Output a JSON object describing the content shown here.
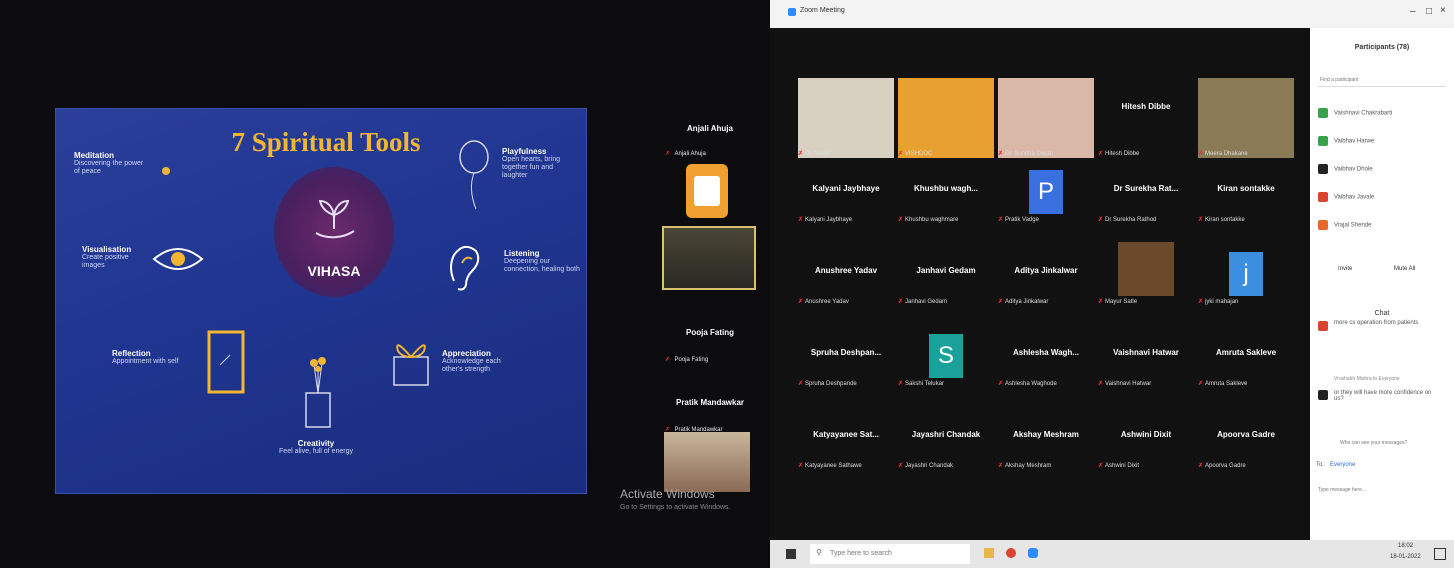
{
  "slide": {
    "title": "7 Spiritual Tools",
    "logo_text": "VIHASA",
    "tools": [
      {
        "heading": "Meditation",
        "desc": "Discovering the power of peace"
      },
      {
        "heading": "Visualisation",
        "desc": "Create positive images"
      },
      {
        "heading": "Reflection",
        "desc": "Appointment with self"
      },
      {
        "heading": "Creativity",
        "desc": "Feel alive, full of energy"
      },
      {
        "heading": "Appreciation",
        "desc": "Acknowledge each other's strength"
      },
      {
        "heading": "Listening",
        "desc": "Deepening our connection, healing both"
      },
      {
        "heading": "Playfulness",
        "desc": "Open hearts, bring together fun and laughter"
      }
    ]
  },
  "left_gallery": {
    "names": [
      "Anjali Ahuja",
      "Pooja Fating",
      "Pratik Mandawkar"
    ],
    "labels": [
      "Anjali Ahuja",
      "Pooja Fating",
      "Pratik Mandawkar"
    ],
    "activate": "Activate Windows",
    "activate_sub": "Go to Settings to activate Windows."
  },
  "zoom": {
    "window_title": "Zoom Meeting",
    "tiles": [
      {
        "name": "",
        "label": "Dr. Nikhil"
      },
      {
        "name": "",
        "label": "VISHDOC"
      },
      {
        "name": "",
        "label": "Dr. Sunitha Diwan"
      },
      {
        "name": "Hitesh Dibbe",
        "label": "Hitesh Dibbe"
      },
      {
        "name": "",
        "label": "Meera Dhakane"
      },
      {
        "name": "Kalyani Jaybhaye",
        "label": "Kalyani Jaybhaye"
      },
      {
        "name": "Khushbu wagh...",
        "label": "Khushbu waghmare"
      },
      {
        "name": "",
        "label": "Pratik Vadge",
        "letter": "P",
        "color": "#3a6fe0"
      },
      {
        "name": "Dr Surekha Rat...",
        "label": "Dr Surekha Rathod"
      },
      {
        "name": "Kiran sontakke",
        "label": "Kiran sontakke"
      },
      {
        "name": "Anushree Yadav",
        "label": "Anushree Yadav"
      },
      {
        "name": "Janhavi Gedam",
        "label": "Janhavi Gedam"
      },
      {
        "name": "Aditya Jinkalwar",
        "label": "Aditya Jinkalwar"
      },
      {
        "name": "",
        "label": "Mayur Satle"
      },
      {
        "name": "",
        "label": "jyki mahajan",
        "letter": "j",
        "color": "#3a8fe0"
      },
      {
        "name": "Spruha Deshpan...",
        "label": "Spruha Deshpande"
      },
      {
        "name": "",
        "label": "Sakshi Telukar",
        "letter": "S",
        "color": "#1aa19a"
      },
      {
        "name": "Ashlesha Wagh...",
        "label": "Ashlesha Waghode"
      },
      {
        "name": "Vaishnavi Hatwar",
        "label": "Vaishnavi Hatwar"
      },
      {
        "name": "Amruta Sakleve",
        "label": "Amruta Sakleve"
      },
      {
        "name": "Katyayanee Sat...",
        "label": "Katyayanee Sathawe"
      },
      {
        "name": "Jayashri Chandak",
        "label": "Jayashri Chandak"
      },
      {
        "name": "Akshay Meshram",
        "label": "Akshay Meshram"
      },
      {
        "name": "Ashwini Dixit",
        "label": "Ashwini Dixit"
      },
      {
        "name": "Apoorva Gadre",
        "label": "Apoorva Gadre"
      }
    ]
  },
  "panel": {
    "participants_title": "Participants (78)",
    "search_placeholder": "Find a participant",
    "participants": [
      {
        "name": "Vaishnavi Chakrabarti",
        "color": "#3aa04a"
      },
      {
        "name": "Vaibhav Harwe",
        "color": "#3aa04a"
      },
      {
        "name": "Vaibhav Dhole",
        "color": "#222222"
      },
      {
        "name": "Vaibhav Javale",
        "color": "#d9432f"
      },
      {
        "name": "Vrajal Shende",
        "color": "#e8672a"
      }
    ],
    "invite": "Invite",
    "mute_all": "Mute All",
    "chat_title": "Chat",
    "messages": [
      {
        "text": "more cs operation from patients",
        "color": "#d9432f"
      },
      {
        "text": "or they will have more confidence on us?",
        "color": "#222222"
      }
    ],
    "sender_line": "Vrushabh Mishra to Everyone",
    "who_see": "Who can see your messages?",
    "to_label": "To:",
    "to_value": "Everyone",
    "message_placeholder": "Type message here..."
  },
  "taskbar": {
    "search_placeholder": "Type here to search",
    "time": "18:02",
    "date": "18-01-2022"
  }
}
